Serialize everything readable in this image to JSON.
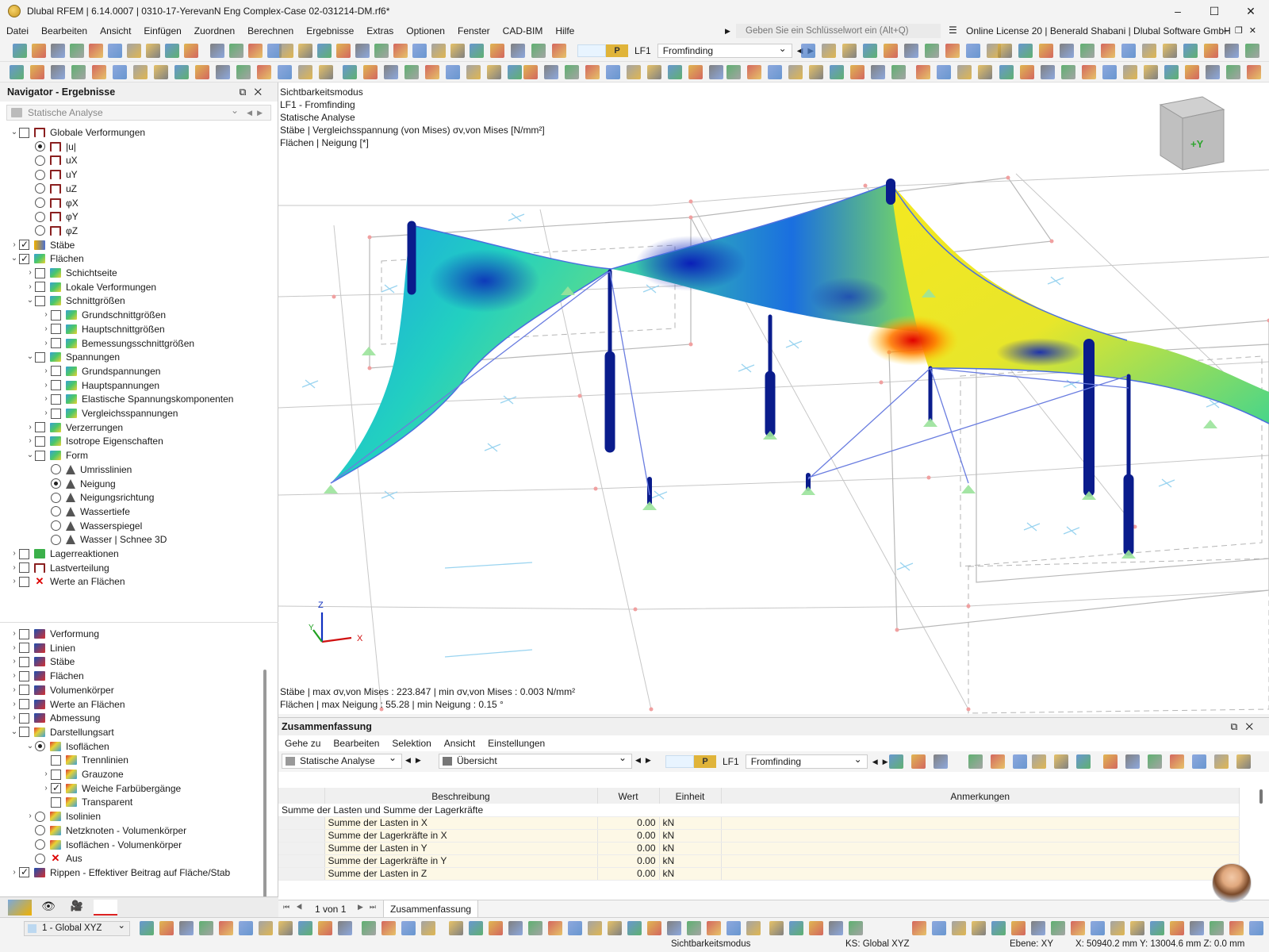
{
  "window": {
    "title": "Dlubal RFEM | 6.14.0007 | 0310-17-YerevanN Eng Complex-Case 02-031214-DM.rf6*",
    "controls": [
      "–",
      "☐",
      "✕"
    ]
  },
  "menu": {
    "items": [
      "Datei",
      "Bearbeiten",
      "Ansicht",
      "Einfügen",
      "Zuordnen",
      "Berechnen",
      "Ergebnisse",
      "Extras",
      "Optionen",
      "Fenster",
      "CAD-BIM",
      "Hilfe"
    ],
    "search_placeholder": "Geben Sie ein Schlüsselwort ein (Alt+Q)",
    "license": "Online License 20 | Benerald Shabani | Dlubal Software GmbH"
  },
  "toolbar": {
    "loadcase_type": "P",
    "loadcase_id": "LF1",
    "loadcase_name": "Fromfinding"
  },
  "navigator": {
    "title": "Navigator - Ergebnisse",
    "analysis": "Statische Analyse",
    "tree": [
      {
        "label": "Globale Verformungen",
        "level": 0,
        "exp": "v",
        "ctl": "cb",
        "on": false,
        "icon": "def"
      },
      {
        "label": "|u|",
        "level": 1,
        "exp": "",
        "ctl": "rd",
        "on": true,
        "icon": "def"
      },
      {
        "label": "uX",
        "level": 1,
        "exp": "",
        "ctl": "rd",
        "on": false,
        "icon": "def"
      },
      {
        "label": "uY",
        "level": 1,
        "exp": "",
        "ctl": "rd",
        "on": false,
        "icon": "def"
      },
      {
        "label": "uZ",
        "level": 1,
        "exp": "",
        "ctl": "rd",
        "on": false,
        "icon": "def"
      },
      {
        "label": "φX",
        "level": 1,
        "exp": "",
        "ctl": "rd",
        "on": false,
        "icon": "def"
      },
      {
        "label": "φY",
        "level": 1,
        "exp": "",
        "ctl": "rd",
        "on": false,
        "icon": "def"
      },
      {
        "label": "φZ",
        "level": 1,
        "exp": "",
        "ctl": "rd",
        "on": false,
        "icon": "def"
      },
      {
        "label": "Stäbe",
        "level": 0,
        "exp": ">",
        "ctl": "cb",
        "on": true,
        "icon": "bar"
      },
      {
        "label": "Flächen",
        "level": 0,
        "exp": "v",
        "ctl": "cb",
        "on": true,
        "icon": "surf"
      },
      {
        "label": "Schichtseite",
        "level": 1,
        "exp": ">",
        "ctl": "cb",
        "on": false,
        "icon": "surf"
      },
      {
        "label": "Lokale Verformungen",
        "level": 1,
        "exp": ">",
        "ctl": "cb",
        "on": false,
        "icon": "surf"
      },
      {
        "label": "Schnittgrößen",
        "level": 1,
        "exp": "v",
        "ctl": "cb",
        "on": false,
        "icon": "surf"
      },
      {
        "label": "Grundschnittgrößen",
        "level": 2,
        "exp": ">",
        "ctl": "cb",
        "on": false,
        "icon": "surf"
      },
      {
        "label": "Hauptschnittgrößen",
        "level": 2,
        "exp": ">",
        "ctl": "cb",
        "on": false,
        "icon": "surf"
      },
      {
        "label": "Bemessungsschnittgrößen",
        "level": 2,
        "exp": ">",
        "ctl": "cb",
        "on": false,
        "icon": "surf"
      },
      {
        "label": "Spannungen",
        "level": 1,
        "exp": "v",
        "ctl": "cb",
        "on": false,
        "icon": "surf"
      },
      {
        "label": "Grundspannungen",
        "level": 2,
        "exp": ">",
        "ctl": "cb",
        "on": false,
        "icon": "surf"
      },
      {
        "label": "Hauptspannungen",
        "level": 2,
        "exp": ">",
        "ctl": "cb",
        "on": false,
        "icon": "surf"
      },
      {
        "label": "Elastische Spannungskomponenten",
        "level": 2,
        "exp": ">",
        "ctl": "cb",
        "on": false,
        "icon": "surf"
      },
      {
        "label": "Vergleichsspannungen",
        "level": 2,
        "exp": ">",
        "ctl": "cb",
        "on": false,
        "icon": "surf"
      },
      {
        "label": "Verzerrungen",
        "level": 1,
        "exp": ">",
        "ctl": "cb",
        "on": false,
        "icon": "surf"
      },
      {
        "label": "Isotrope Eigenschaften",
        "level": 1,
        "exp": ">",
        "ctl": "cb",
        "on": false,
        "icon": "surf"
      },
      {
        "label": "Form",
        "level": 1,
        "exp": "v",
        "ctl": "cb",
        "on": false,
        "icon": "surf"
      },
      {
        "label": "Umrisslinien",
        "level": 2,
        "exp": "",
        "ctl": "rd",
        "on": false,
        "icon": "tri"
      },
      {
        "label": "Neigung",
        "level": 2,
        "exp": "",
        "ctl": "rd",
        "on": true,
        "icon": "tri"
      },
      {
        "label": "Neigungsrichtung",
        "level": 2,
        "exp": "",
        "ctl": "rd",
        "on": false,
        "icon": "tri"
      },
      {
        "label": "Wassertiefe",
        "level": 2,
        "exp": "",
        "ctl": "rd",
        "on": false,
        "icon": "tri"
      },
      {
        "label": "Wasserspiegel",
        "level": 2,
        "exp": "",
        "ctl": "rd",
        "on": false,
        "icon": "tri"
      },
      {
        "label": "Wasser | Schnee 3D",
        "level": 2,
        "exp": "",
        "ctl": "rd",
        "on": false,
        "icon": "tri"
      },
      {
        "label": "Lagerreaktionen",
        "level": 0,
        "exp": ">",
        "ctl": "cb",
        "on": false,
        "icon": "grn"
      },
      {
        "label": "Lastverteilung",
        "level": 0,
        "exp": ">",
        "ctl": "cb",
        "on": false,
        "icon": "def"
      },
      {
        "label": "Werte an Flächen",
        "level": 0,
        "exp": ">",
        "ctl": "cb",
        "on": false,
        "icon": "red"
      }
    ],
    "tree2": [
      {
        "label": "Verformung",
        "level": 0,
        "exp": ">",
        "ctl": "cb",
        "on": false,
        "icon": "line"
      },
      {
        "label": "Linien",
        "level": 0,
        "exp": ">",
        "ctl": "cb",
        "on": false,
        "icon": "line"
      },
      {
        "label": "Stäbe",
        "level": 0,
        "exp": ">",
        "ctl": "cb",
        "on": false,
        "icon": "line"
      },
      {
        "label": "Flächen",
        "level": 0,
        "exp": ">",
        "ctl": "cb",
        "on": false,
        "icon": "line"
      },
      {
        "label": "Volumenkörper",
        "level": 0,
        "exp": ">",
        "ctl": "cb",
        "on": false,
        "icon": "line"
      },
      {
        "label": "Werte an Flächen",
        "level": 0,
        "exp": ">",
        "ctl": "cb",
        "on": false,
        "icon": "line"
      },
      {
        "label": "Abmessung",
        "level": 0,
        "exp": ">",
        "ctl": "cb",
        "on": false,
        "icon": "line"
      },
      {
        "label": "Darstellungsart",
        "level": 0,
        "exp": "v",
        "ctl": "cb",
        "on": false,
        "icon": "iso"
      },
      {
        "label": "Isoflächen",
        "level": 1,
        "exp": "v",
        "ctl": "rd",
        "on": true,
        "icon": "iso"
      },
      {
        "label": "Trennlinien",
        "level": 2,
        "exp": "",
        "ctl": "cb",
        "on": false,
        "icon": "iso"
      },
      {
        "label": "Grauzone",
        "level": 2,
        "exp": ">",
        "ctl": "cb",
        "on": false,
        "icon": "iso"
      },
      {
        "label": "Weiche Farbübergänge",
        "level": 2,
        "exp": ">",
        "ctl": "cb",
        "on": true,
        "icon": "iso"
      },
      {
        "label": "Transparent",
        "level": 2,
        "exp": "",
        "ctl": "cb",
        "on": false,
        "icon": "iso"
      },
      {
        "label": "Isolinien",
        "level": 1,
        "exp": ">",
        "ctl": "rd",
        "on": false,
        "icon": "iso"
      },
      {
        "label": "Netzknoten - Volumenkörper",
        "level": 1,
        "exp": "",
        "ctl": "rd",
        "on": false,
        "icon": "iso"
      },
      {
        "label": "Isoflächen - Volumenkörper",
        "level": 1,
        "exp": "",
        "ctl": "rd",
        "on": false,
        "icon": "iso"
      },
      {
        "label": "Aus",
        "level": 1,
        "exp": "",
        "ctl": "rd",
        "on": false,
        "icon": "red"
      },
      {
        "label": "Rippen - Effektiver Beitrag auf Fläche/Stab",
        "level": 0,
        "exp": ">",
        "ctl": "cb",
        "on": true,
        "icon": "line"
      }
    ]
  },
  "viewport": {
    "info_lines": [
      "Sichtbarkeitsmodus",
      "LF1 - Fromfinding",
      "Statische Analyse",
      "Stäbe | Vergleichsspannung (von Mises) σv,von Mises [N/mm²]",
      "Flächen | Neigung  [*]"
    ],
    "result_lines": [
      "Stäbe | max σv,von Mises : 223.847 | min σv,von Mises : 0.003 N/mm²",
      "Flächen | max Neigung : 55.28 | min Neigung : 0.15 °"
    ],
    "cube_label": "+Y",
    "axes": {
      "x": "X",
      "y": "Y",
      "z": "Z"
    }
  },
  "summary": {
    "title": "Zusammenfassung",
    "menu": [
      "Gehe zu",
      "Bearbeiten",
      "Selektion",
      "Ansicht",
      "Einstellungen"
    ],
    "analysis": "Statische Analyse",
    "view": "Übersicht",
    "lc_type": "P",
    "lc_id": "LF1",
    "lc_name": "Fromfinding",
    "columns": [
      "Beschreibung",
      "Wert",
      "Einheit",
      "Anmerkungen"
    ],
    "group": "Summe der Lasten und Summe der Lagerkräfte",
    "rows": [
      {
        "desc": "Summe der Lasten in X",
        "value": "0.00",
        "unit": "kN"
      },
      {
        "desc": "Summe der Lagerkräfte in X",
        "value": "0.00",
        "unit": "kN"
      },
      {
        "desc": "Summe der Lasten in Y",
        "value": "0.00",
        "unit": "kN"
      },
      {
        "desc": "Summe der Lagerkräfte in Y",
        "value": "0.00",
        "unit": "kN"
      },
      {
        "desc": "Summe der Lasten in Z",
        "value": "0.00",
        "unit": "kN"
      }
    ],
    "pager": "1 von 1",
    "tab": "Zusammenfassung"
  },
  "status": {
    "coord_system": "1 - Global XYZ",
    "mode": "Sichtbarkeitsmodus",
    "ks": "KS: Global XYZ",
    "plane": "Ebene: XY",
    "coords": "X: 50940.2 mm  Y: 13004.6 mm  Z: 0.0 mm"
  }
}
